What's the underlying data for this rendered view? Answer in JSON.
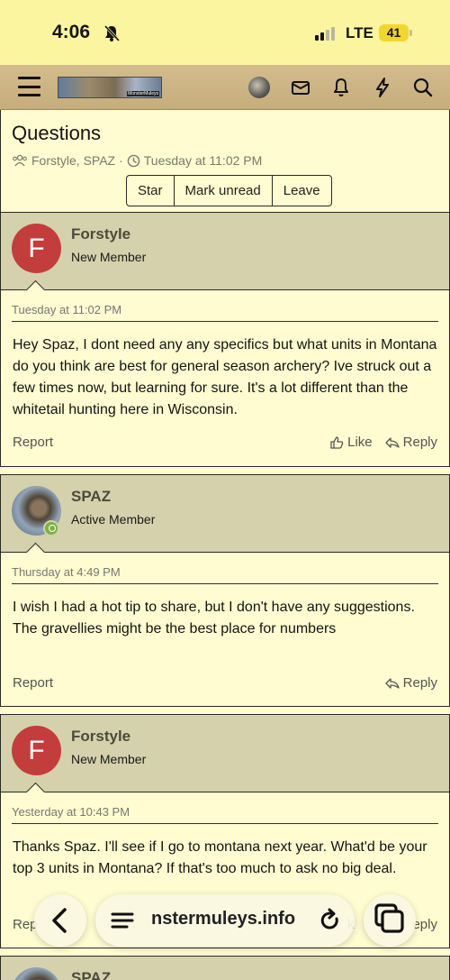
{
  "status_bar": {
    "time": "4:06",
    "network": "LTE",
    "battery": "41"
  },
  "nav": {
    "logo_text": "MonsterMuleys"
  },
  "thread": {
    "title": "Questions",
    "participants": "Forstyle, SPAZ",
    "separator": "·",
    "date": "Tuesday at 11:02 PM",
    "buttons": [
      "Star",
      "Mark unread",
      "Leave"
    ]
  },
  "messages": [
    {
      "avatar_letter": "F",
      "username": "Forstyle",
      "user_title": "New Member",
      "date": "Tuesday at 11:02 PM",
      "body": "Hey Spaz, I dont need any any specifics but what units in Montana do you think are best for general season archery? Ive struck out a few times now, but learning for sure. It's a lot different than the whitetail hunting here in Wisconsin.",
      "report": "Report",
      "like": "Like",
      "reply": "Reply"
    },
    {
      "username": "SPAZ",
      "user_title": "Active Member",
      "date": "Thursday at 4:49 PM",
      "body": "I wish I had a hot tip to share, but I don't have any suggestions. The gravellies might be the best place for numbers",
      "report": "Report",
      "reply": "Reply"
    },
    {
      "avatar_letter": "F",
      "username": "Forstyle",
      "user_title": "New Member",
      "date": "Yesterday at 10:43 PM",
      "body": "Thanks Spaz. I'll see if I go to montana next year. What'd be your top 3 units in Montana? If that's too much to ask no big deal.",
      "report": "Rep",
      "like_partial": "k",
      "reply_partial": "eply"
    },
    {
      "username": "SPAZ"
    }
  ],
  "browser": {
    "url": "nstermuleys.info"
  }
}
